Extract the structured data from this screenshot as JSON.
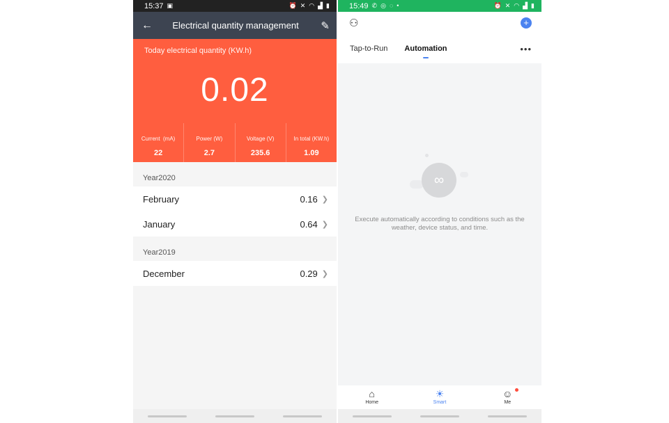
{
  "left": {
    "status": {
      "time": "15:37",
      "icons": [
        "image-icon",
        "alarm-icon",
        "mute-icon",
        "wifi-icon",
        "signal-icon",
        "battery-icon"
      ]
    },
    "header": {
      "title": "Electrical quantity management"
    },
    "hero": {
      "label": "Today electrical quantity (KW.h)",
      "value": "0.02",
      "color": "#ff5e3f"
    },
    "stats": [
      {
        "label": "Current  (mA)",
        "value": "22"
      },
      {
        "label": "Power (W)",
        "value": "2.7"
      },
      {
        "label": "Voltage (V)",
        "value": "235.6"
      },
      {
        "label": "In total (KW.h)",
        "value": "1.09"
      }
    ],
    "years": [
      {
        "label": "Year2020",
        "months": [
          {
            "name": "February",
            "value": "0.16"
          },
          {
            "name": "January",
            "value": "0.64"
          }
        ]
      },
      {
        "label": "Year2019",
        "months": [
          {
            "name": "December",
            "value": "0.29"
          }
        ]
      }
    ]
  },
  "right": {
    "status": {
      "time": "15:49",
      "color": "#1fb45f"
    },
    "tabs": [
      {
        "label": "Tap-to-Run",
        "active": false
      },
      {
        "label": "Automation",
        "active": true
      }
    ],
    "empty_text": "Execute automatically according to conditions such as the weather, device status, and time.",
    "bottom_nav": [
      {
        "label": "Home",
        "icon": "home-icon"
      },
      {
        "label": "Smart",
        "icon": "sun-icon",
        "active": true
      },
      {
        "label": "Me",
        "icon": "profile-icon"
      }
    ],
    "accent": "#4b83f0"
  }
}
